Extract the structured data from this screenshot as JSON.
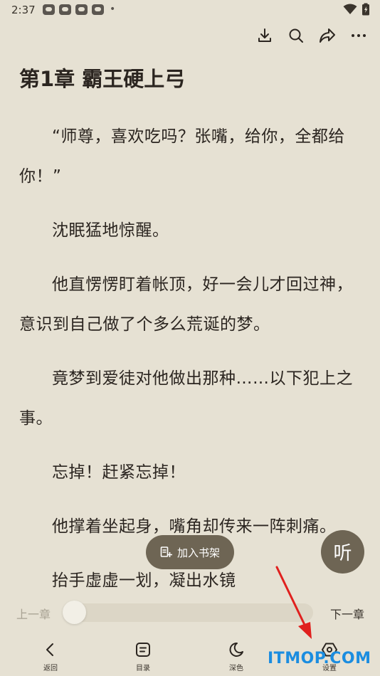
{
  "status_bar": {
    "time": "2:37",
    "dot": "•"
  },
  "chapter": {
    "title": "第1章 霸王硬上弓",
    "paragraphs": [
      "“师尊，喜欢吃吗？张嘴，给你，全都给你！”",
      "沈眠猛地惊醒。",
      "他直愣愣盯着帐顶，好一会儿才回过神，意识到自己做了个多么荒诞的梦。",
      "竟梦到爱徒对他做出那种……以下犯上之事。",
      "忘掉！赶紧忘掉！",
      "他撑着坐起身，嘴角却传来一阵刺痛。",
      "抬手虚虚一划，凝出水镜"
    ]
  },
  "actions": {
    "add_shelf": "加入书架",
    "listen": "听"
  },
  "progress": {
    "prev": "上一章",
    "next": "下一章",
    "value": 0
  },
  "nav": {
    "back": "返回",
    "catalog": "目录",
    "dark": "深色",
    "settings": "设置"
  },
  "watermark": "ITMOP.COM",
  "colors": {
    "background": "#e6e1d3",
    "accent": "#6e6554",
    "arrow": "#e0201e",
    "watermark": "#1b8de0"
  }
}
